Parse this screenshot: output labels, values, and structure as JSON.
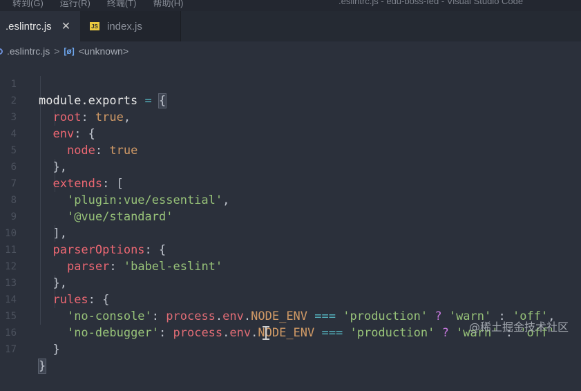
{
  "menubar": {
    "items": [
      "转到(G)",
      "运行(R)",
      "终端(T)",
      "帮助(H)"
    ],
    "window_title": ".eslintrc.js - edu-boss-fed - Visual Studio Code"
  },
  "tabs": [
    {
      "label": ".eslintrc.js",
      "close": "✕"
    },
    {
      "label": "index.js",
      "icon": "JS"
    }
  ],
  "breadcrumb": {
    "file": ".eslintrc.js",
    "separator": ">",
    "symbol_icon": "[ø]",
    "symbol": "<unknown>"
  },
  "editor": {
    "line_numbers": [
      "1",
      "2",
      "3",
      "4",
      "5",
      "6",
      "7",
      "8",
      "9",
      "10",
      "11",
      "12",
      "13",
      "14",
      "15",
      "16",
      "17"
    ],
    "lines": [
      "module.exports = {",
      "  root: true,",
      "  env: {",
      "    node: true",
      "  },",
      "  extends: [",
      "    'plugin:vue/essential',",
      "    '@vue/standard'",
      "  ],",
      "  parserOptions: {",
      "    parser: 'babel-eslint'",
      "  },",
      "  rules: {",
      "    'no-console': process.env.NODE_ENV === 'production' ? 'warn' : 'off',",
      "    'no-debugger': process.env.NODE_ENV === 'production' ? 'warn' : 'off'",
      "  }",
      "}"
    ],
    "tokens": {
      "module_exports": "module.exports",
      "eq": "=",
      "open_brace": "{",
      "close_brace": "}",
      "root": "root",
      "true": "true",
      "env": "env",
      "node": "node",
      "extends": "extends",
      "plugin": "'plugin:vue/essential'",
      "standard": "'@vue/standard'",
      "parserOptions": "parserOptions",
      "parser": "parser",
      "babel": "'babel-eslint'",
      "rules": "rules",
      "noconsole": "'no-console'",
      "nodebugger": "'no-debugger'",
      "process": "process",
      "envprop": "env",
      "node_env": "NODE_ENV",
      "triple_eq": "===",
      "production": "'production'",
      "q": "?",
      "warn": "'warn'",
      "colon": ":",
      "off": "'off'"
    }
  },
  "watermark": "@稀土掘金技术社区",
  "colors": {
    "background": "#2b303b",
    "key": "#eb6772",
    "string": "#98c379",
    "boolean": "#d19a66"
  }
}
